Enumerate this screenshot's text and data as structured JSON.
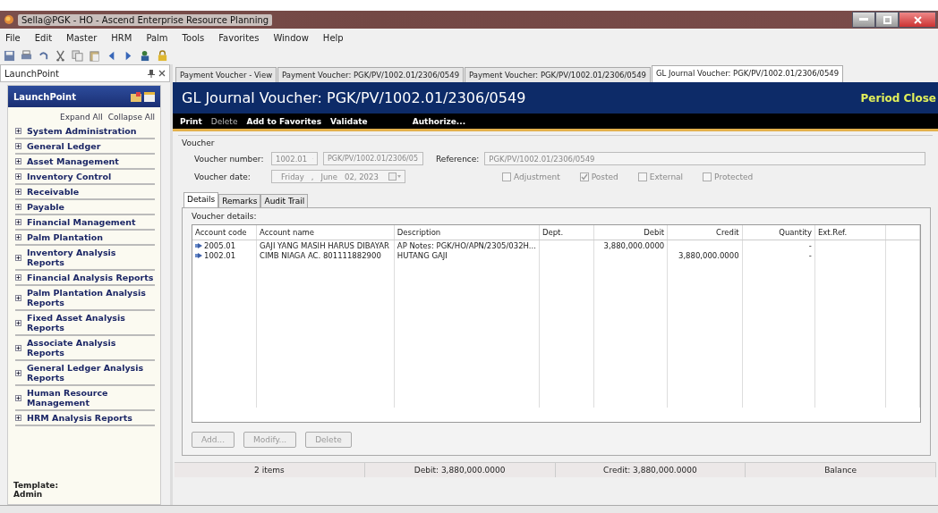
{
  "window": {
    "title": "Sella@PGK - HO - Ascend Enterprise Resource Planning"
  },
  "menu": [
    "File",
    "Edit",
    "Master",
    "HRM",
    "Palm",
    "Tools",
    "Favorites",
    "Window",
    "Help"
  ],
  "launchpoint": {
    "panel_title": "LaunchPoint",
    "header": "LaunchPoint",
    "expand_all": "Expand All",
    "collapse_all": "Collapse All",
    "items": [
      {
        "label": "System Administration",
        "expanded": false
      },
      {
        "label": "General Ledger",
        "expanded": false
      },
      {
        "label": "Asset Management",
        "expanded": false
      },
      {
        "label": "Inventory Control",
        "expanded": false
      },
      {
        "label": "Receivable",
        "expanded": false
      },
      {
        "label": "Payable",
        "expanded": false
      },
      {
        "label": "Financial Management",
        "expanded": false
      },
      {
        "label": "Palm Plantation",
        "expanded": false
      },
      {
        "label": "Inventory Analysis Reports",
        "expanded": false
      },
      {
        "label": "Financial Analysis Reports",
        "expanded": false
      },
      {
        "label": "Palm Plantation Analysis Reports",
        "expanded": false
      },
      {
        "label": "Fixed Asset Analysis Reports",
        "expanded": false
      },
      {
        "label": "Associate Analysis Reports",
        "expanded": false
      },
      {
        "label": "General Ledger Analysis Reports",
        "expanded": false
      },
      {
        "label": "Human Resource Management",
        "expanded": false
      },
      {
        "label": "HRM Analysis Reports",
        "expanded": false
      }
    ],
    "template_label": "Template:",
    "template_value": "Admin"
  },
  "doc_tabs": [
    {
      "label": "Payment Voucher - View",
      "selected": false
    },
    {
      "label": "Payment Voucher: PGK/PV/1002.01/2306/0549",
      "selected": false
    },
    {
      "label": "Payment Voucher: PGK/PV/1002.01/2306/0549",
      "selected": false
    },
    {
      "label": "GL Journal Voucher: PGK/PV/1002.01/2306/0549",
      "selected": true
    }
  ],
  "banner": {
    "title": "GL Journal Voucher: PGK/PV/1002.01/2306/0549",
    "status": "Period Close"
  },
  "actions": [
    {
      "label": "Print",
      "disabled": false
    },
    {
      "label": "Delete",
      "disabled": true
    },
    {
      "label": "Add to Favorites",
      "disabled": false
    },
    {
      "label": "Validate",
      "disabled": false
    },
    {
      "label": "Authorize...",
      "disabled": false
    }
  ],
  "voucher": {
    "title": "Voucher",
    "number_label": "Voucher number:",
    "number_prefix": "1002.01",
    "number_value": "PGK/PV/1002.01/2306/05",
    "reference_label": "Reference:",
    "reference_value": "PGK/PV/1002.01/2306/0549",
    "date_label": "Voucher date:",
    "date_day": "Friday",
    "date_sep": ",",
    "date_month": "June",
    "date_rest": "02, 2023",
    "checkboxes": [
      {
        "label": "Adjustment",
        "checked": false
      },
      {
        "label": "Posted",
        "checked": true
      },
      {
        "label": "External",
        "checked": false
      },
      {
        "label": "Protected",
        "checked": false
      }
    ]
  },
  "detail_tabs": [
    {
      "label": "Details",
      "selected": true
    },
    {
      "label": "Remarks",
      "selected": false
    },
    {
      "label": "Audit Trail",
      "selected": false
    }
  ],
  "details": {
    "title": "Voucher details:",
    "columns": [
      "Account code",
      "Account name",
      "Description",
      "Dept.",
      "Debit",
      "Credit",
      "Quantity",
      "Ext.Ref."
    ],
    "rows": [
      [
        "2005.01",
        "GAJI YANG MASIH HARUS DIBAYAR",
        "AP Notes: PGK/HO/APN/2305/032H...",
        "",
        "3,880,000.0000",
        "",
        "-",
        ""
      ],
      [
        "1002.01",
        "CIMB NIAGA AC. 801111882900",
        "HUTANG GAJI",
        "",
        "",
        "3,880,000.0000",
        "-",
        ""
      ]
    ],
    "buttons": [
      {
        "label": "Add...",
        "disabled": true
      },
      {
        "label": "Modify...",
        "disabled": true
      },
      {
        "label": "Delete",
        "disabled": true
      }
    ]
  },
  "summary": [
    "2 items",
    "Debit: 3,880,000.0000",
    "Credit: 3,880,000.0000",
    "Balance"
  ]
}
